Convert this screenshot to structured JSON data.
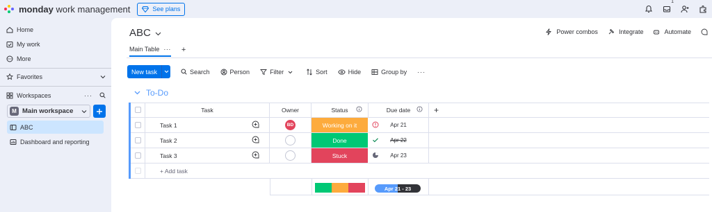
{
  "topbar": {
    "brand_bold": "monday",
    "brand_rest": " work management",
    "see_plans": "See plans",
    "inbox_count": "1",
    "icons": [
      "bell-icon",
      "inbox-icon",
      "invite-members-icon",
      "apps-icon"
    ]
  },
  "sidebar": {
    "home": "Home",
    "my_work": "My work",
    "more": "More",
    "favorites": "Favorites",
    "workspaces": "Workspaces",
    "workspace_name": "Main workspace",
    "workspace_initial": "M",
    "boards": [
      {
        "label": "ABC",
        "active": true
      },
      {
        "label": "Dashboard and reporting",
        "active": false
      }
    ]
  },
  "board": {
    "title": "ABC",
    "actions": [
      "Power combos",
      "Integrate",
      "Automate"
    ],
    "tab_main": "Main Table",
    "tab_more": "···",
    "tab_add": "+"
  },
  "toolbar": {
    "new_task": "New task",
    "search": "Search",
    "person": "Person",
    "filter": "Filter",
    "sort": "Sort",
    "hide": "Hide",
    "group_by": "Group by",
    "more": "···"
  },
  "group": {
    "title": "To-Do",
    "color": "#579bfc",
    "columns": {
      "task": "Task",
      "owner": "Owner",
      "status": "Status",
      "due_date": "Due date",
      "add": "+"
    },
    "rows": [
      {
        "task": "Task 1",
        "owner": "BD",
        "status": "Working on it",
        "status_color": "#fdab3d",
        "due": "Apr 21",
        "due_icon": "alert-icon"
      },
      {
        "task": "Task 2",
        "owner": "",
        "status": "Done",
        "status_color": "#00c875",
        "due": "Apr 22",
        "due_icon": "check-icon"
      },
      {
        "task": "Task 3",
        "owner": "",
        "status": "Stuck",
        "status_color": "#e2445c",
        "due": "Apr 23",
        "due_icon": "clock-icon"
      }
    ],
    "add_task": "+ Add task",
    "summary_date": "Apr 21 - 23",
    "summary_status_fractions": [
      0.333,
      0.333,
      0.334
    ]
  }
}
